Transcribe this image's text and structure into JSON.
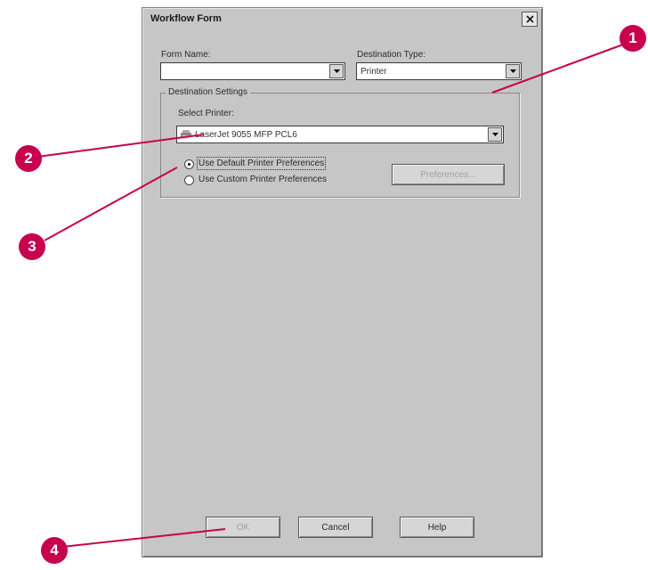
{
  "dialog": {
    "title": "Workflow Form",
    "form_name_label": "Form Name:",
    "form_name_value": "",
    "destination_type_label": "Destination Type:",
    "destination_type_value": "Printer",
    "group_label": "Destination Settings",
    "select_printer_label": "Select Printer:",
    "select_printer_value": "LaserJet 9055 MFP PCL6",
    "radio_default": "Use Default Printer Preferences",
    "radio_custom": "Use Custom Printer Preferences",
    "radio_selected": "default",
    "preferences_button": "Preferences...",
    "ok_button": "OK",
    "cancel_button": "Cancel",
    "help_button": "Help"
  },
  "callouts": [
    "1",
    "2",
    "3",
    "4"
  ],
  "colors": {
    "callout": "#c8004e",
    "dialog_bg": "#c6c6c6"
  }
}
